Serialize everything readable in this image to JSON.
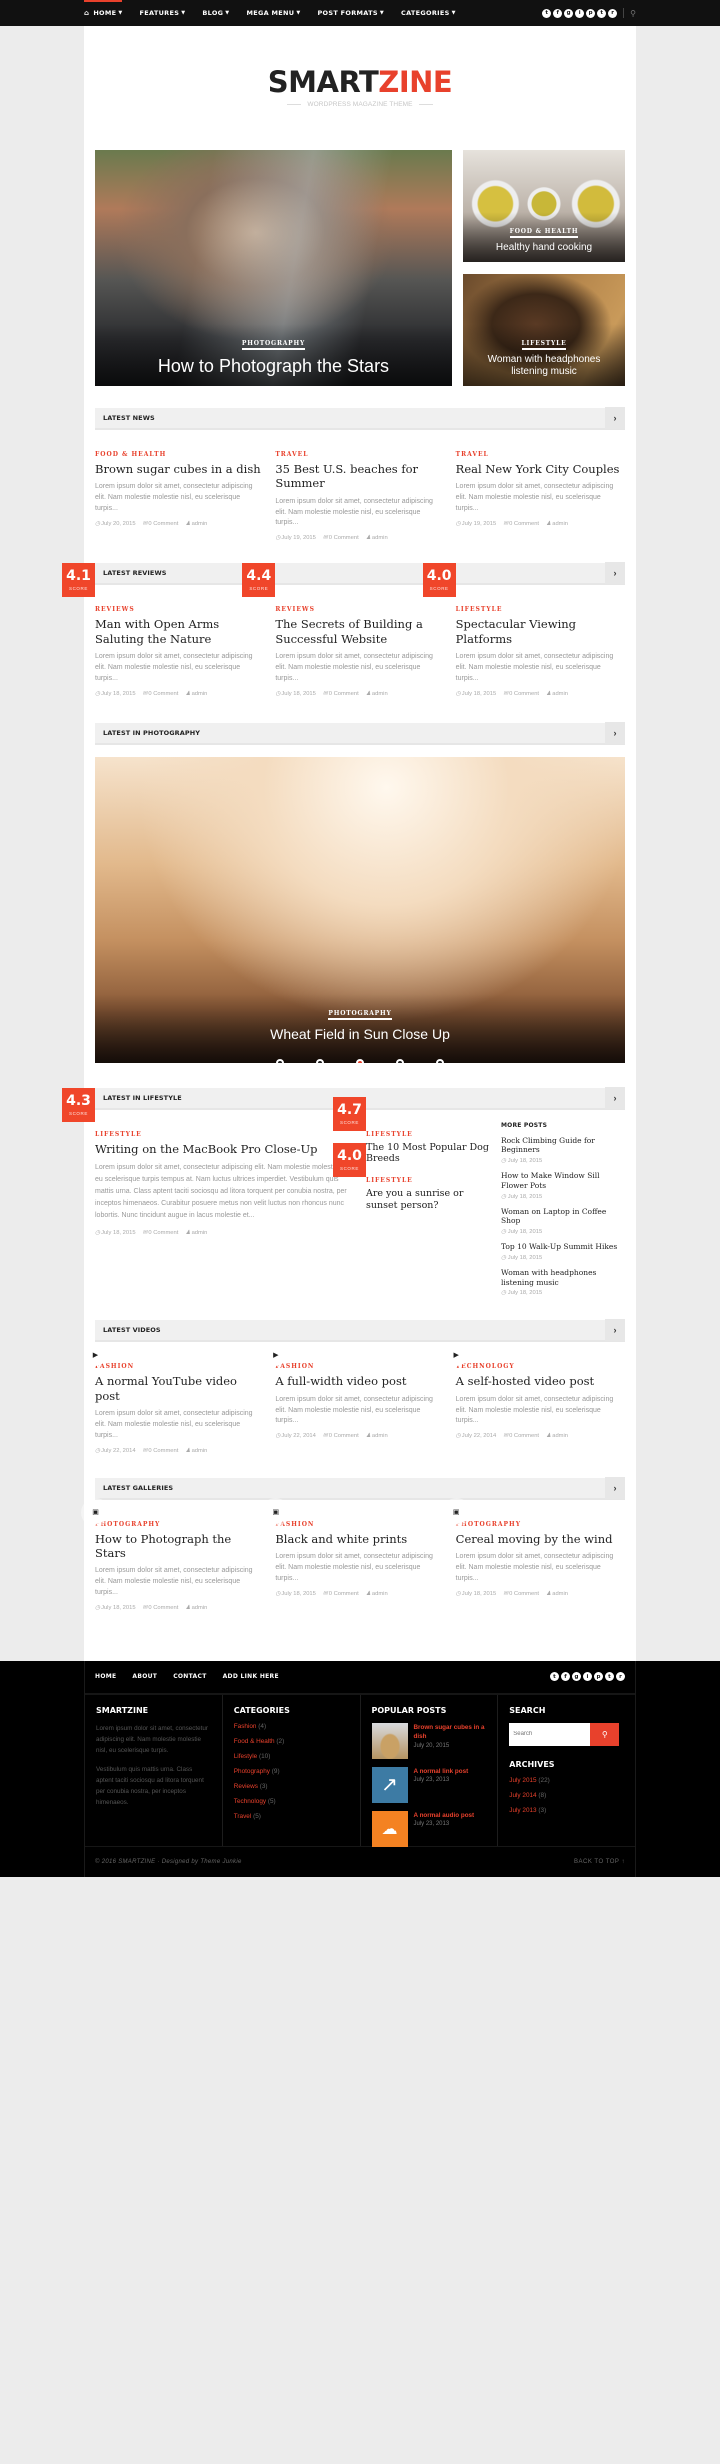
{
  "topnav": {
    "items": [
      {
        "label": "HOME",
        "icon": "home-icon",
        "active": true
      },
      {
        "label": "FEATURES"
      },
      {
        "label": "BLOG"
      },
      {
        "label": "MEGA MENU"
      },
      {
        "label": "POST FORMATS"
      },
      {
        "label": "CATEGORIES"
      }
    ],
    "social": [
      "twitter-icon",
      "facebook-icon",
      "google-plus-icon",
      "instagram-icon",
      "pinterest-icon",
      "tumblr-icon",
      "rss-icon"
    ],
    "social_glyphs": [
      "t",
      "f",
      "g",
      "i",
      "p",
      "t",
      "r"
    ],
    "search_icon": "search-icon"
  },
  "header": {
    "logo_part1": "SMART",
    "logo_part2": "ZINE",
    "tagline": "WORDPRESS MAGAZINE THEME"
  },
  "hero": {
    "main": {
      "category": "PHOTOGRAPHY",
      "title": "How to Photograph the Stars"
    },
    "side": [
      {
        "category": "FOOD & HEALTH",
        "title": "Healthy hand cooking"
      },
      {
        "category": "LIFESTYLE",
        "title": "Woman with headphones listening music"
      }
    ]
  },
  "excerpt_short": "Lorem ipsum dolor sit amet, consectetur adipiscing elit. Nam molestie molestie nisl, eu scelerisque turpis...",
  "comment_label": "0 Comment",
  "author": "admin",
  "score_label": "SCORE",
  "sections": {
    "latest_news": {
      "title": "LATEST NEWS",
      "posts": [
        {
          "category": "FOOD & HEALTH",
          "title": "Brown sugar cubes in a dish",
          "date": "July 20, 2015"
        },
        {
          "category": "TRAVEL",
          "title": "35 Best U.S. beaches for Summer",
          "date": "July 19, 2015"
        },
        {
          "category": "TRAVEL",
          "title": "Real New York City Couples",
          "date": "July 19, 2015"
        }
      ]
    },
    "latest_reviews": {
      "title": "LATEST REVIEWS",
      "posts": [
        {
          "category": "REVIEWS",
          "title": "Man with Open Arms Saluting the Nature",
          "date": "July 18, 2015",
          "score": "4.1"
        },
        {
          "category": "REVIEWS",
          "title": "The Secrets of Building a Successful Website",
          "date": "July 18, 2015",
          "score": "4.4"
        },
        {
          "category": "LIFESTYLE",
          "title": "Spectacular Viewing Platforms",
          "date": "July 18, 2015",
          "score": "4.0"
        }
      ]
    },
    "latest_photography": {
      "title": "LATEST IN PHOTOGRAPHY",
      "slide": {
        "category": "PHOTOGRAPHY",
        "title": "Wheat Field in Sun Close Up"
      },
      "slide_count": 5,
      "active_slide": 3
    },
    "latest_lifestyle": {
      "title": "LATEST IN LIFESTYLE",
      "main": {
        "category": "LIFESTYLE",
        "title": "Writing on the MacBook Pro Close-Up",
        "score": "4.3",
        "excerpt": "Lorem ipsum dolor sit amet, consectetur adipiscing elit. Nam molestie molestie nisl, eu scelerisque turpis tempus at. Nam luctus ultrices imperdiet. Vestibulum quis mattis urna. Class aptent taciti sociosqu ad litora torquent per conubia nostra, per inceptos himenaeos. Curabitur posuere metus non velit luctus non rhoncus nunc lobortis. Nunc tincidunt augue in lacus molestie et...",
        "date": "July 18, 2015"
      },
      "mid": [
        {
          "category": "LIFESTYLE",
          "title": "The 10 Most Popular Dog Breeds",
          "score": "4.7"
        },
        {
          "category": "LIFESTYLE",
          "title": "Are you a sunrise or sunset person?",
          "score": "4.0"
        }
      ],
      "more_posts_title": "MORE POSTS",
      "more_posts": [
        {
          "title": "Rock Climbing Guide for Beginners",
          "date": "July 18, 2015"
        },
        {
          "title": "How to Make Window Sill Flower Pots",
          "date": "July 18, 2015"
        },
        {
          "title": "Woman on Laptop in Coffee Shop",
          "date": "July 18, 2015"
        },
        {
          "title": "Top 10 Walk-Up Summit Hikes",
          "date": "July 18, 2015"
        },
        {
          "title": "Woman with headphones listening music",
          "date": "July 18, 2015"
        }
      ]
    },
    "latest_videos": {
      "title": "LATEST VIDEOS",
      "posts": [
        {
          "category": "FASHION",
          "title": "A normal YouTube video post",
          "date": "July 22, 2014"
        },
        {
          "category": "FASHION",
          "title": "A full-width video post",
          "date": "July 22, 2014"
        },
        {
          "category": "TECHNOLOGY",
          "title": "A self-hosted video post",
          "date": "July 22, 2014"
        }
      ]
    },
    "latest_galleries": {
      "title": "LATEST GALLERIES",
      "posts": [
        {
          "category": "PHOTOGRAPHY",
          "title": "How to Photograph the Stars",
          "date": "July 18, 2015"
        },
        {
          "category": "FASHION",
          "title": "Black and white prints",
          "date": "July 18, 2015"
        },
        {
          "category": "PHOTOGRAPHY",
          "title": "Cereal moving by the wind",
          "date": "July 18, 2015"
        }
      ]
    }
  },
  "footer": {
    "nav": [
      "HOME",
      "ABOUT",
      "CONTACT",
      "ADD LINK HERE"
    ],
    "about": {
      "title": "SMARTZINE",
      "p1": "Lorem ipsum dolor sit amet, consectetur adipiscing elit. Nam molestie molestie nisl, eu scelerisque turpis.",
      "p2": "Vestibulum quis mattis urna. Class aptent taciti sociosqu ad litora torquent per conubia nostra, per inceptos himenaeos."
    },
    "categories": {
      "title": "CATEGORIES",
      "items": [
        {
          "name": "Fashion",
          "count": "(4)"
        },
        {
          "name": "Food & Health",
          "count": "(2)"
        },
        {
          "name": "Lifestyle",
          "count": "(10)"
        },
        {
          "name": "Photography",
          "count": "(9)"
        },
        {
          "name": "Reviews",
          "count": "(3)"
        },
        {
          "name": "Technology",
          "count": "(5)"
        },
        {
          "name": "Travel",
          "count": "(5)"
        }
      ]
    },
    "popular": {
      "title": "POPULAR POSTS",
      "items": [
        {
          "title": "Brown sugar cubes in a dish",
          "date": "July 20, 2015"
        },
        {
          "title": "A normal link post",
          "date": "July 23, 2013"
        },
        {
          "title": "A normal audio post",
          "date": "July 23, 2013"
        }
      ]
    },
    "search": {
      "title": "SEARCH",
      "placeholder": "Search"
    },
    "archives": {
      "title": "ARCHIVES",
      "items": [
        {
          "name": "July 2015",
          "count": "(22)"
        },
        {
          "name": "July 2014",
          "count": "(8)"
        },
        {
          "name": "July 2013",
          "count": "(3)"
        }
      ]
    },
    "copyright": "© 2016 SMARTZINE · Designed by Theme Junkie",
    "back_to_top": "BACK TO TOP ↑"
  },
  "colors": {
    "accent": "#e8412c",
    "nav_bg": "#111111",
    "footer_bg": "#000000"
  }
}
